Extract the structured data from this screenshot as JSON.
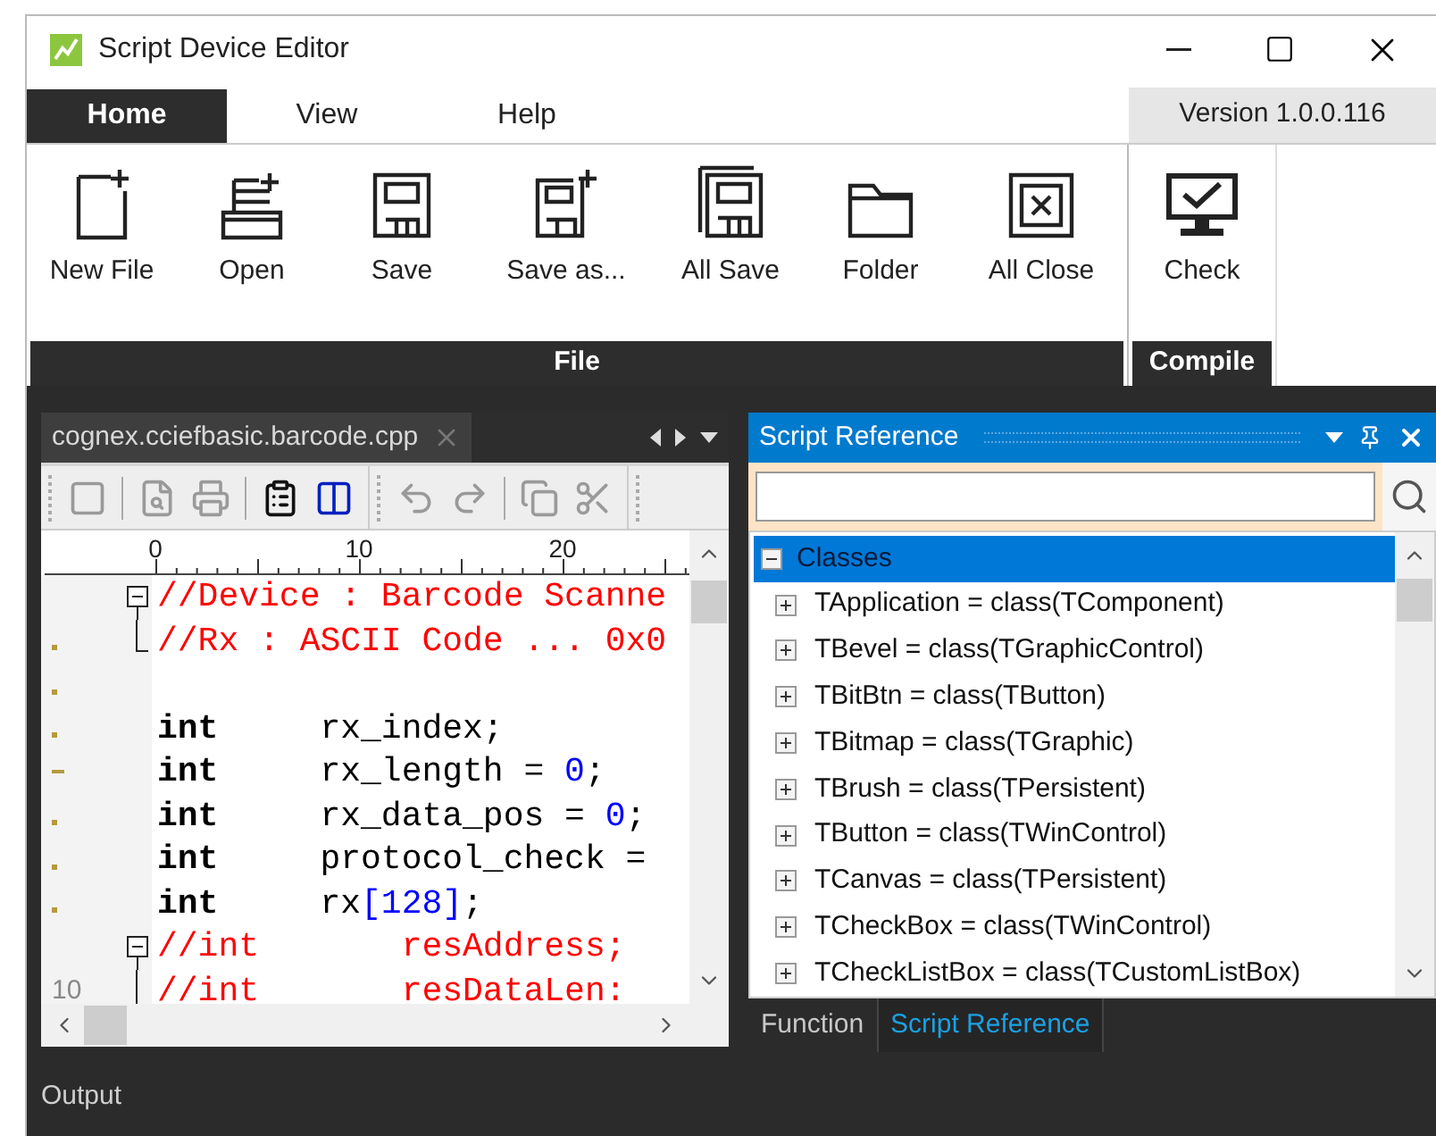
{
  "window": {
    "title": "Script Device Editor"
  },
  "menu_tabs": [
    {
      "label": "Home",
      "selected": true
    },
    {
      "label": "View",
      "selected": false
    },
    {
      "label": "Help",
      "selected": false
    }
  ],
  "version": "Version 1.0.0.116",
  "ribbon_groups": [
    {
      "label": "File",
      "buttons": [
        "New File",
        "Open",
        "Save",
        "Save as...",
        "All Save",
        "Folder",
        "All Close"
      ]
    },
    {
      "label": "Compile",
      "buttons": [
        "Check"
      ]
    }
  ],
  "editor": {
    "tab": "cognex.cciefbasic.barcode.cpp",
    "toolbar_groups": [
      [
        {
          "kind": "stop",
          "disabled": true
        },
        {
          "kind": "separator"
        },
        {
          "kind": "preview",
          "disabled": true
        },
        {
          "kind": "print",
          "disabled": true
        },
        {
          "kind": "separator"
        },
        {
          "kind": "properties",
          "disabled": false
        },
        {
          "kind": "columns",
          "disabled": false
        }
      ],
      [
        {
          "kind": "undo",
          "disabled": true
        },
        {
          "kind": "redo",
          "disabled": true
        },
        {
          "kind": "separator"
        },
        {
          "kind": "copy",
          "disabled": true
        },
        {
          "kind": "cut",
          "disabled": true
        }
      ]
    ],
    "ruler": [
      "0",
      "10",
      "20"
    ],
    "lines": [
      {
        "marked": false,
        "current": false,
        "fold_start": true,
        "fold_body": false,
        "fold_end": false,
        "tokens": [
          {
            "text": "//Device : Barcode Scanne",
            "kind": "comment"
          }
        ]
      },
      {
        "marked": true,
        "current": false,
        "fold_start": false,
        "fold_body": true,
        "fold_end": true,
        "tokens": [
          {
            "text": "//Rx : ASCII Code ... 0x0",
            "kind": "comment"
          }
        ]
      },
      {
        "marked": true,
        "current": false,
        "fold_start": false,
        "fold_body": false,
        "fold_end": false
      },
      {
        "marked": true,
        "current": false,
        "fold_start": false,
        "fold_body": false,
        "fold_end": false,
        "tokens": [
          {
            "text": "int",
            "kind": "keyword"
          },
          {
            "text": "rx_index;",
            "kind": "plain",
            "tab": true
          }
        ]
      },
      {
        "marked": true,
        "current": true,
        "fold_start": false,
        "fold_body": false,
        "fold_end": false,
        "tokens": [
          {
            "text": "int",
            "kind": "keyword"
          },
          {
            "text": "rx_length = ",
            "kind": "plain",
            "tab": true
          },
          {
            "text": "0",
            "kind": "number"
          },
          {
            "text": ";",
            "kind": "plain"
          }
        ]
      },
      {
        "marked": true,
        "current": false,
        "fold_start": false,
        "fold_body": false,
        "fold_end": false,
        "tokens": [
          {
            "text": "int",
            "kind": "keyword"
          },
          {
            "text": "rx_data_pos = ",
            "kind": "plain",
            "tab": true
          },
          {
            "text": "0",
            "kind": "number"
          },
          {
            "text": ";",
            "kind": "plain"
          }
        ]
      },
      {
        "marked": true,
        "current": false,
        "fold_start": false,
        "fold_body": false,
        "fold_end": false,
        "tokens": [
          {
            "text": "int",
            "kind": "keyword"
          },
          {
            "text": "protocol_check =",
            "kind": "plain",
            "tab": true
          }
        ]
      },
      {
        "marked": true,
        "current": false,
        "fold_start": false,
        "fold_body": false,
        "fold_end": false,
        "tokens": [
          {
            "text": "int",
            "kind": "keyword"
          },
          {
            "text": "rx",
            "kind": "plain",
            "tab": true
          },
          {
            "text": "[128]",
            "kind": "number"
          },
          {
            "text": ";",
            "kind": "plain"
          }
        ]
      },
      {
        "marked": false,
        "current": false,
        "fold_start": true,
        "fold_body": false,
        "fold_end": false,
        "tokens": [
          {
            "text": "//int       resAddress;",
            "kind": "comment"
          }
        ]
      },
      {
        "marked": false,
        "current": false,
        "number": "10",
        "fold_start": false,
        "fold_body": true,
        "fold_end": false,
        "tokens": [
          {
            "text": "//int       resDataLen:",
            "kind": "comment"
          }
        ]
      }
    ]
  },
  "reference": {
    "title": "Script Reference",
    "tree": {
      "label": "Classes",
      "selected": true,
      "expanded": true,
      "children": [
        {
          "label": "TApplication = class(TComponent)",
          "selected": false,
          "expanded": false
        },
        {
          "label": "TBevel = class(TGraphicControl)",
          "selected": false,
          "expanded": false
        },
        {
          "label": "TBitBtn = class(TButton)",
          "selected": false,
          "expanded": false
        },
        {
          "label": "TBitmap = class(TGraphic)",
          "selected": false,
          "expanded": false
        },
        {
          "label": "TBrush = class(TPersistent)",
          "selected": false,
          "expanded": false
        },
        {
          "label": "TButton = class(TWinControl)",
          "selected": false,
          "expanded": false
        },
        {
          "label": "TCanvas = class(TPersistent)",
          "selected": false,
          "expanded": false
        },
        {
          "label": "TCheckBox = class(TWinControl)",
          "selected": false,
          "expanded": false
        },
        {
          "label": "TCheckListBox = class(TCustomListBox)",
          "selected": false,
          "expanded": false
        }
      ]
    },
    "tabs": [
      {
        "label": "Function",
        "selected": false
      },
      {
        "label": "Script Reference",
        "selected": true
      }
    ]
  },
  "output": {
    "title": "Output"
  }
}
